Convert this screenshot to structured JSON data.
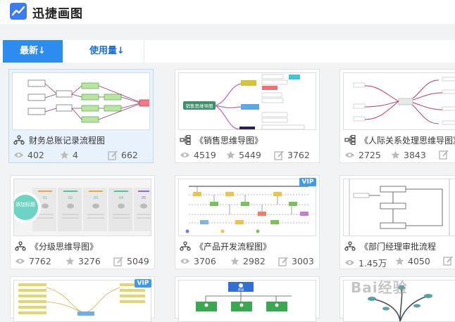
{
  "app": {
    "name": "迅捷画图"
  },
  "tabs": [
    {
      "label": "最新↓",
      "active": true
    },
    {
      "label": "使用量↓",
      "active": false
    }
  ],
  "cards": [
    {
      "title": "财务总账记录流程图",
      "views": "402",
      "likes": "4",
      "edits": "662",
      "icon": "flowchart-icon",
      "vip": false,
      "selected": true
    },
    {
      "title": "《销售思维导图》",
      "views": "4519",
      "likes": "5449",
      "edits": "3762",
      "icon": "mindmap-icon",
      "vip": false,
      "selected": false
    },
    {
      "title": "《人际关系处理思维导图》",
      "views": "2725",
      "likes": "3843",
      "edits": "",
      "icon": "mindmap-icon",
      "vip": false,
      "selected": false
    },
    {
      "title": "《分级思维导图》",
      "views": "7762",
      "likes": "3276",
      "edits": "5049",
      "icon": "flowchart-icon",
      "vip": false,
      "selected": false
    },
    {
      "title": "《产品开发流程图》",
      "views": "3706",
      "likes": "2982",
      "edits": "3003",
      "icon": "flowchart-icon",
      "vip": true,
      "selected": false
    },
    {
      "title": "《部门经理审批流程",
      "views": "1.45万",
      "likes": "4050",
      "edits": "",
      "icon": "flowchart-icon",
      "vip": false,
      "selected": false
    }
  ],
  "bottom_cards": [
    {
      "vip": true
    },
    {
      "vip": false
    },
    {
      "vip": false
    }
  ],
  "thumb_text": {
    "sales_center": "销售思维导图",
    "tiered_badge": "添加标题",
    "steps": [
      "01",
      "02",
      "03",
      "04",
      "05"
    ],
    "bottom_center": "总经"
  },
  "vip_label": "VIP",
  "watermark": "Bai经验",
  "colors": {
    "accent": "#2e8cf0",
    "selected_card": "#e7f2fc",
    "vip": "#3d9bef"
  }
}
